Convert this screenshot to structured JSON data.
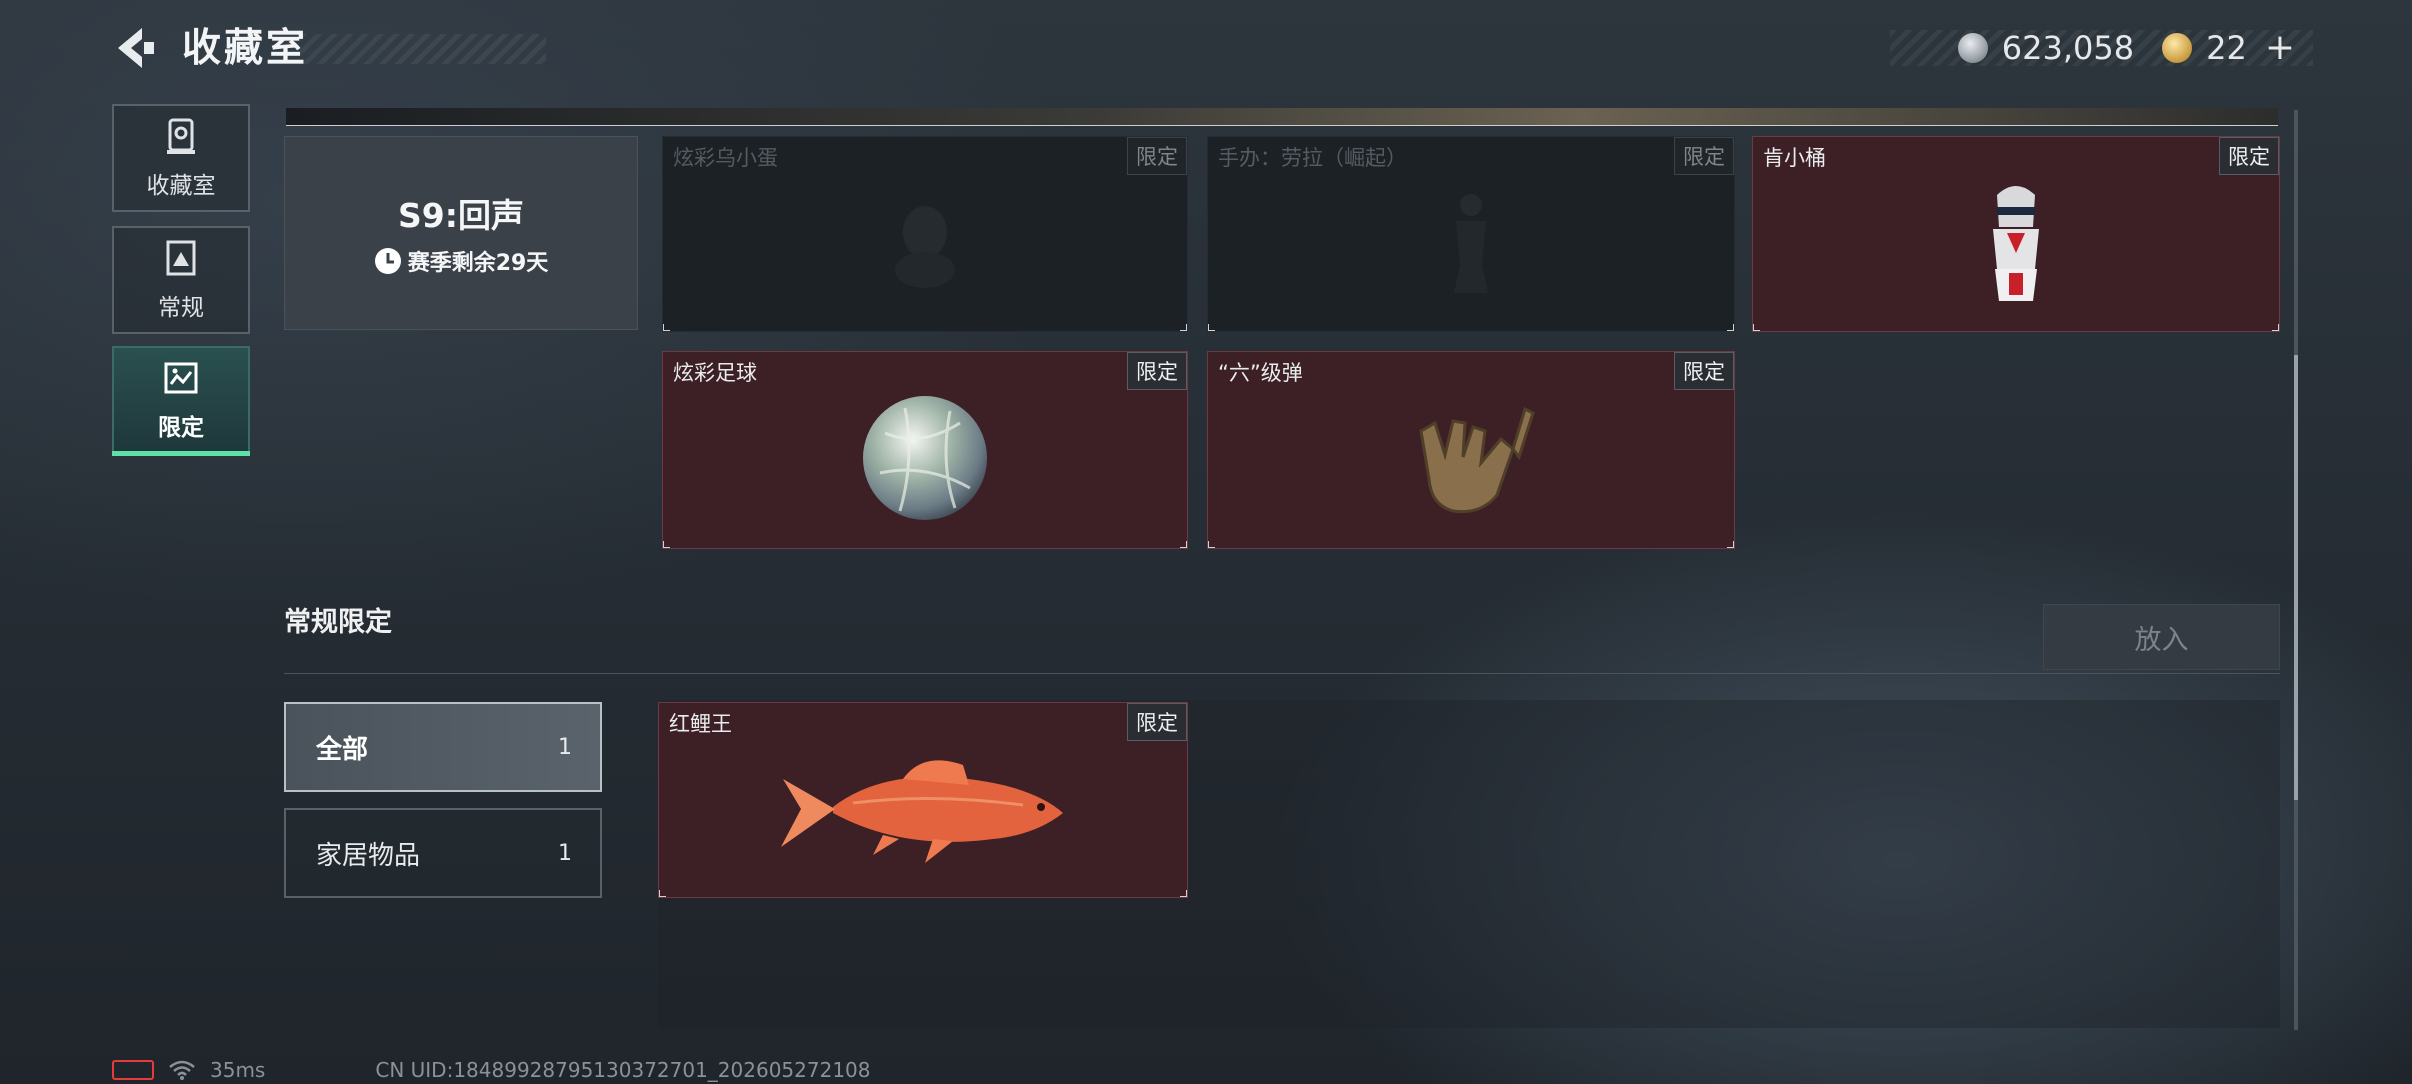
{
  "header": {
    "title": "收藏室",
    "currency": [
      {
        "icon": "silver-coin-icon",
        "value": "623,058"
      },
      {
        "icon": "gold-coin-icon",
        "value": "22"
      }
    ],
    "plus": "+"
  },
  "sidebar": {
    "items": [
      {
        "label": "收藏室",
        "icon": "collection-icon",
        "active": false
      },
      {
        "label": "常规",
        "icon": "regular-icon",
        "active": false
      },
      {
        "label": "限定",
        "icon": "limited-icon",
        "active": true
      }
    ]
  },
  "season": {
    "name": "S9:回声",
    "remaining": "赛季剩余29天"
  },
  "season_items": [
    {
      "name": "炫彩乌小蛋",
      "tag": "限定",
      "owned": false
    },
    {
      "name": "手办：劳拉（崛起）",
      "tag": "限定",
      "owned": false
    },
    {
      "name": "肯小桶",
      "tag": "限定",
      "owned": true
    },
    {
      "name": "炫彩足球",
      "tag": "限定",
      "owned": true
    },
    {
      "name": "“六”级弹",
      "tag": "限定",
      "owned": true
    }
  ],
  "regular_limited": {
    "title": "常规限定",
    "put_button": "放入",
    "filters": [
      {
        "label": "全部",
        "count": "1",
        "active": true
      },
      {
        "label": "家居物品",
        "count": "1",
        "active": false
      }
    ],
    "items": [
      {
        "name": "红鲤王",
        "tag": "限定",
        "owned": true
      }
    ]
  },
  "status_bar": {
    "ping": "35ms",
    "uid": "CN UID:184899287951303727​01_202605272108"
  },
  "colors": {
    "accent_green": "#5ee0a8",
    "owned_card": "#3d2026",
    "locked_card": "#1c2126"
  }
}
